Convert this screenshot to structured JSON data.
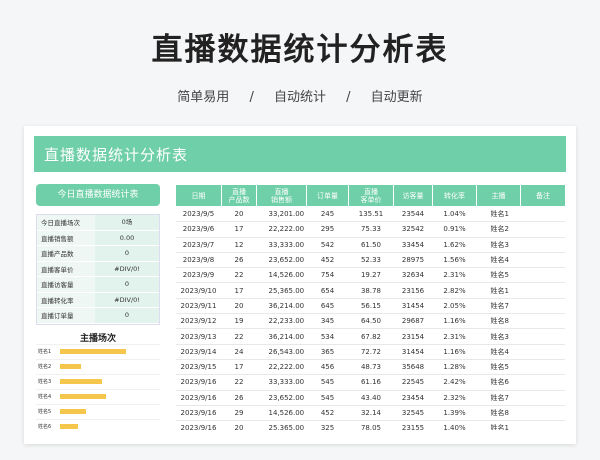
{
  "header": {
    "title": "直播数据统计分析表",
    "features": [
      "简单易用",
      "自动统计",
      "自动更新"
    ],
    "separator": "/"
  },
  "sheet": {
    "title": "直播数据统计分析表"
  },
  "summary": {
    "title": "今日直播数据统计表",
    "rows": [
      {
        "label": "今日直播场次",
        "value": "0场"
      },
      {
        "label": "直播销售额",
        "value": "0.00"
      },
      {
        "label": "直播产品数",
        "value": "0"
      },
      {
        "label": "直播客单价",
        "value": "#DIV/0!"
      },
      {
        "label": "直播访客量",
        "value": "0"
      },
      {
        "label": "直播转化率",
        "value": "#DIV/0!"
      },
      {
        "label": "直播订单量",
        "value": "0"
      }
    ]
  },
  "chart_data": {
    "type": "bar",
    "title": "主播场次",
    "categories": [
      "姓名1",
      "姓名2",
      "姓名3",
      "姓名4",
      "姓名5",
      "姓名6"
    ],
    "values": [
      5,
      1.6,
      3.2,
      3.5,
      2,
      1.4
    ]
  },
  "table": {
    "headers": [
      "日期",
      "直播\n产品数",
      "直播\n销售额",
      "订单量",
      "直播\n客单价",
      "访客量",
      "转化率",
      "主播",
      "备注"
    ],
    "rows": [
      [
        "2023/9/5",
        "20",
        "33,201.00",
        "245",
        "135.51",
        "23544",
        "1.04%",
        "姓名1",
        ""
      ],
      [
        "2023/9/6",
        "17",
        "22,222.00",
        "295",
        "75.33",
        "32542",
        "0.91%",
        "姓名2",
        ""
      ],
      [
        "2023/9/7",
        "12",
        "33,333.00",
        "542",
        "61.50",
        "33454",
        "1.62%",
        "姓名3",
        ""
      ],
      [
        "2023/9/8",
        "26",
        "23,652.00",
        "452",
        "52.33",
        "28975",
        "1.56%",
        "姓名4",
        ""
      ],
      [
        "2023/9/9",
        "22",
        "14,526.00",
        "754",
        "19.27",
        "32634",
        "2.31%",
        "姓名5",
        ""
      ],
      [
        "2023/9/10",
        "17",
        "25,365.00",
        "654",
        "38.78",
        "23156",
        "2.82%",
        "姓名1",
        ""
      ],
      [
        "2023/9/11",
        "20",
        "36,214.00",
        "645",
        "56.15",
        "31454",
        "2.05%",
        "姓名7",
        ""
      ],
      [
        "2023/9/12",
        "19",
        "22,233.00",
        "345",
        "64.50",
        "29687",
        "1.16%",
        "姓名8",
        ""
      ],
      [
        "2023/9/13",
        "22",
        "36,214.00",
        "534",
        "67.82",
        "23154",
        "2.31%",
        "姓名3",
        ""
      ],
      [
        "2023/9/14",
        "24",
        "26,543.00",
        "365",
        "72.72",
        "31454",
        "1.16%",
        "姓名4",
        ""
      ],
      [
        "2023/9/15",
        "17",
        "22,222.00",
        "456",
        "48.73",
        "35648",
        "1.28%",
        "姓名5",
        ""
      ],
      [
        "2023/9/16",
        "22",
        "33,333.00",
        "545",
        "61.16",
        "22545",
        "2.42%",
        "姓名6",
        ""
      ],
      [
        "2023/9/16",
        "26",
        "23,652.00",
        "545",
        "43.40",
        "23454",
        "2.32%",
        "姓名7",
        ""
      ],
      [
        "2023/9/16",
        "29",
        "14,526.00",
        "452",
        "32.14",
        "32545",
        "1.39%",
        "姓名8",
        ""
      ],
      [
        "2023/9/16",
        "20",
        "25,365.00",
        "325",
        "78.05",
        "23155",
        "1.40%",
        "姓名1",
        ""
      ]
    ]
  }
}
